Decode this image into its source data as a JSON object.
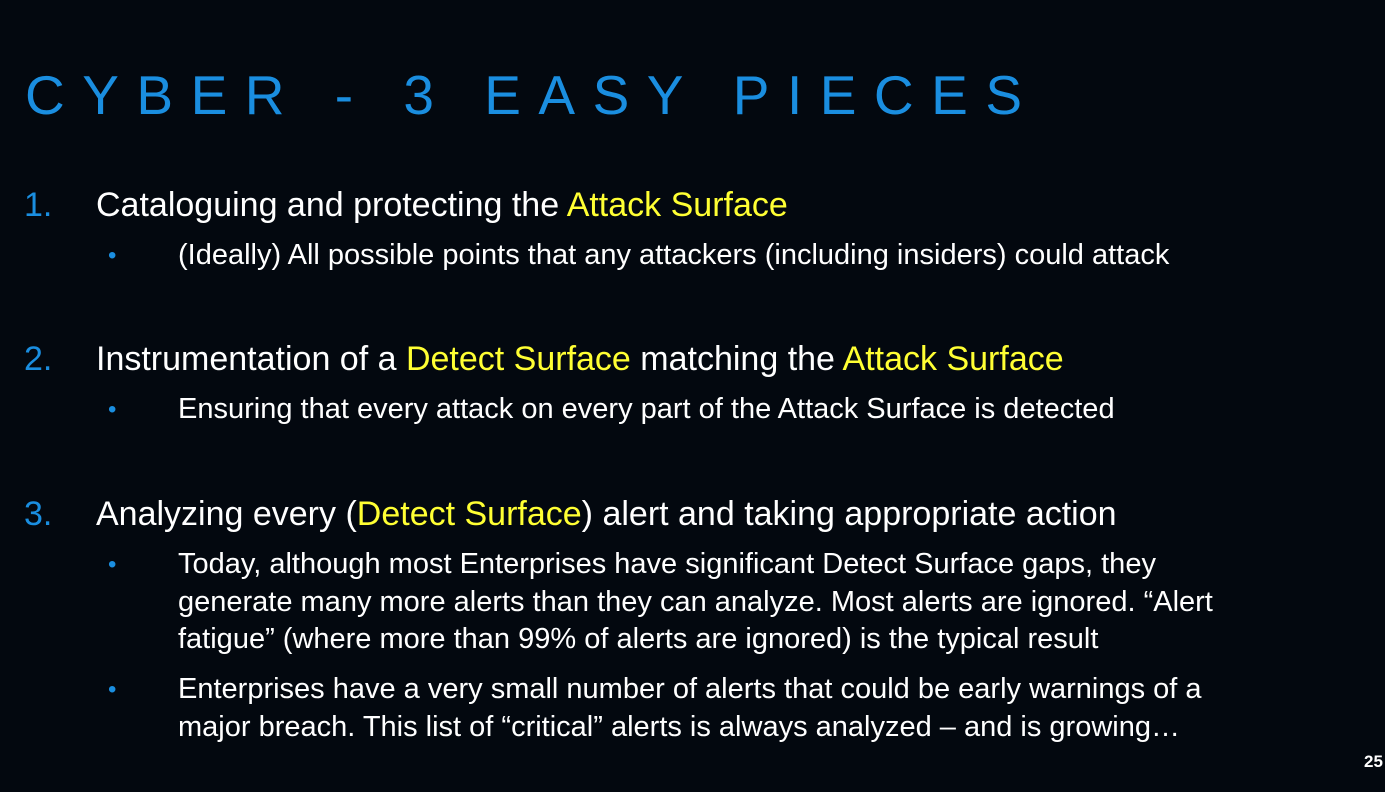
{
  "title": "CYBER - 3 EASY PIECES",
  "items": [
    {
      "number": "1.",
      "heading_parts": [
        "Cataloguing and protecting the ",
        "Attack Surface"
      ],
      "bullets": [
        [
          "(Ideally) All possible points that any attackers (including insiders) could attack"
        ]
      ]
    },
    {
      "number": "2.",
      "heading_parts": [
        "Instrumentation of a ",
        "Detect Surface",
        " matching the ",
        "Attack Surface"
      ],
      "bullets": [
        [
          "Ensuring that every attack on every part of the Attack Surface is detected"
        ]
      ]
    },
    {
      "number": "3.",
      "heading_parts": [
        "Analyzing every (",
        "Detect Surface",
        ") alert and taking appropriate action"
      ],
      "bullets": [
        [
          "Today, although most Enterprises have significant Detect Surface gaps, they",
          "generate many more alerts than they can analyze. Most alerts are ignored. “Alert",
          "fatigue” (where more than 99% of alerts are ignored) is the typical result"
        ],
        [
          "Enterprises have a very small number of alerts that could be early warnings of a",
          "major breach. This list of “critical” alerts is always analyzed – and is growing…"
        ]
      ]
    }
  ],
  "bullet_glyph": "•",
  "page_number": "25",
  "colors": {
    "background": "#03080f",
    "accent_blue": "#1a8ee0",
    "highlight_yellow": "#ffff33",
    "text": "#ffffff"
  }
}
